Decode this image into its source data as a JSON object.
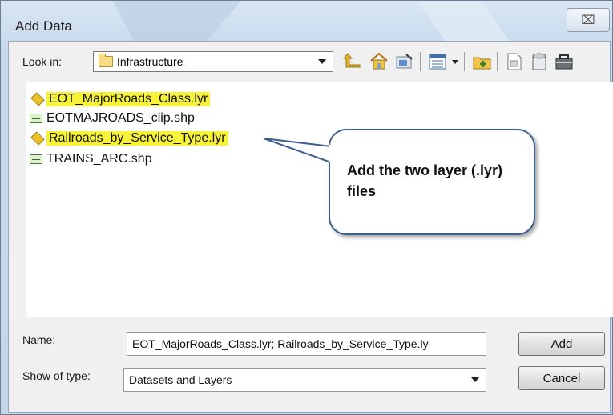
{
  "window": {
    "title": "Add Data",
    "close_label": "⌧"
  },
  "toolbar": {
    "lookin_label": "Look in:",
    "lookin_value": "Infrastructure",
    "tools": [
      "up-one-level-icon",
      "home-icon",
      "connect-folder-icon",
      "view-list-icon",
      "new-folder-icon",
      "new-file-icon",
      "catalog-icon",
      "toolbox-icon"
    ]
  },
  "files": [
    {
      "name": "EOT_MajorRoads_Class.lyr",
      "type": "layer",
      "highlighted": true
    },
    {
      "name": "EOTMAJROADS_clip.shp",
      "type": "shapefile",
      "highlighted": false
    },
    {
      "name": "Railroads_by_Service_Type.lyr",
      "type": "layer",
      "highlighted": true
    },
    {
      "name": "TRAINS_ARC.shp",
      "type": "shapefile",
      "highlighted": false
    }
  ],
  "callout": {
    "text": "Add the two layer (.lyr) files"
  },
  "footer": {
    "name_label": "Name:",
    "name_value": "EOT_MajorRoads_Class.lyr; Railroads_by_Service_Type.ly",
    "type_label": "Show of type:",
    "type_value": "Datasets and Layers",
    "add_label": "Add",
    "cancel_label": "Cancel"
  },
  "colors": {
    "highlight": "#f7f33b",
    "callout_border": "#3c5f8c",
    "titlebar": "#c7d9ec"
  }
}
